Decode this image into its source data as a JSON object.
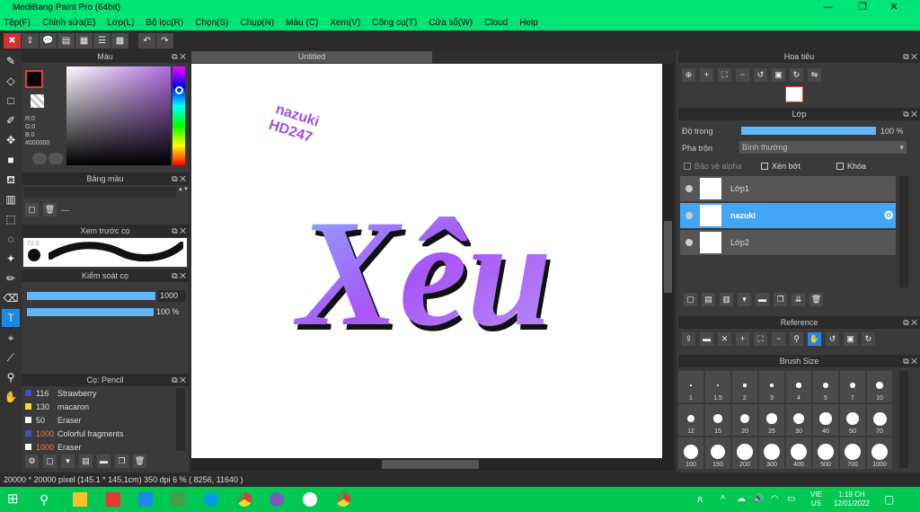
{
  "window": {
    "title": "MediBang Paint Pro (64bit)",
    "minimize": "—",
    "restore": "❐",
    "close": "✕"
  },
  "menu": [
    "Tệp(F)",
    "Chỉnh sửa(E)",
    "Lớp(L)",
    "Bộ lọc(R)",
    "Chọn(S)",
    "Chụp(N)",
    "Màu (C)",
    "Xem(V)",
    "Công cụ(T)",
    "Cửa sổ(W)",
    "Cloud",
    "Help"
  ],
  "color_panel": {
    "title": "Màu",
    "r": "R:0",
    "g": "G:0",
    "b": "B:0",
    "hex": "#000000"
  },
  "palette_panel": {
    "title": "Bảng màu",
    "dash": "---"
  },
  "brush_preview": {
    "title": "Xem trước cọ",
    "size": "72.5"
  },
  "brush_control": {
    "title": "Kiểm soát cọ",
    "size_value": "1000",
    "opacity_value": "100 %"
  },
  "brush_list": {
    "title": "Cọ: Pencil",
    "items": [
      {
        "size": "116",
        "name": "Strawberry",
        "color": "#3f51b5"
      },
      {
        "size": "130",
        "name": "macaron",
        "color": "#fdd835"
      },
      {
        "size": "50",
        "name": "Eraser",
        "color": "#ffffff"
      },
      {
        "size": "1000",
        "name": "Colorful fragments",
        "color": "#3f51b5"
      },
      {
        "size": "1000",
        "name": "Eraser",
        "color": "#ffffff"
      }
    ]
  },
  "canvas": {
    "tab": "Untitled",
    "word": "Xêu",
    "watermark1": "nazuki",
    "watermark2": "HD247"
  },
  "navigator": {
    "title": "Hoa tiêu"
  },
  "layer_panel": {
    "title": "Lớp",
    "opacity_label": "Độ trong",
    "opacity_value": "100 %",
    "blend_label": "Pha trộn",
    "blend_value": "Bình thường",
    "protect_alpha": "Bảo vệ alpha",
    "clip": "Xén bớt",
    "lock": "Khóa",
    "layers": [
      {
        "name": "Lớp1",
        "selected": false
      },
      {
        "name": "nazuki",
        "selected": true
      },
      {
        "name": "Lớp2",
        "selected": false
      }
    ]
  },
  "reference_panel": {
    "title": "Reference"
  },
  "brush_size_panel": {
    "title": "Brush Size",
    "sizes": [
      "1",
      "1.5",
      "2",
      "3",
      "4",
      "5",
      "7",
      "10",
      "12",
      "15",
      "20",
      "25",
      "30",
      "40",
      "50",
      "70",
      "100",
      "150",
      "200",
      "300",
      "400",
      "500",
      "700",
      "1000"
    ]
  },
  "status": {
    "text": "20000 * 20000 pixel   (145.1 * 145.1cm)  350 dpi   6 %   ( 8256, 11640 )"
  },
  "taskbar": {
    "lang1": "VIE",
    "lang2": "US",
    "time": "1:19 CH",
    "date": "12/01/2022"
  },
  "colors": {
    "accent": "#00e676",
    "selection": "#42a5f5",
    "letter_gradient_a": "#a855f7",
    "letter_gradient_b": "#8ab4ff"
  }
}
